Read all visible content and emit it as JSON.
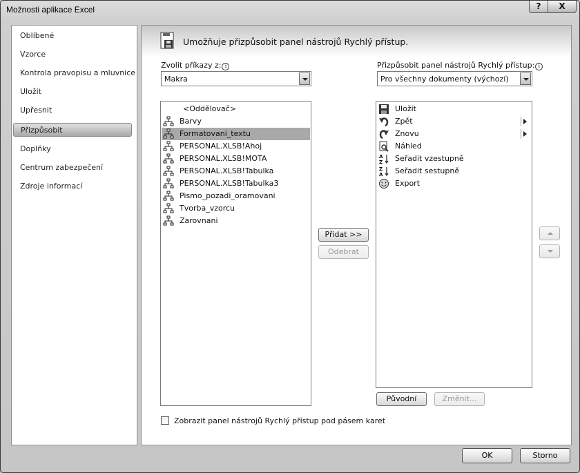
{
  "window": {
    "title": "Možnosti aplikace Excel",
    "help_glyph": "?",
    "close_glyph": "X"
  },
  "sidebar": {
    "items": [
      {
        "label": "Oblíbené",
        "active": false
      },
      {
        "label": "Vzorce",
        "active": false
      },
      {
        "label": "Kontrola pravopisu a mluvnice",
        "active": false
      },
      {
        "label": "Uložit",
        "active": false
      },
      {
        "label": "Upřesnit",
        "active": false
      },
      {
        "label": "Přizpůsobit",
        "active": true
      },
      {
        "label": "Doplňky",
        "active": false
      },
      {
        "label": "Centrum zabezpečení",
        "active": false
      },
      {
        "label": "Zdroje informací",
        "active": false
      }
    ]
  },
  "main": {
    "banner_text": "Umožňuje přizpůsobit panel nástrojů Rychlý přístup.",
    "choose_label": "Zvolit příkazy z:",
    "choose_value": "Makra",
    "customize_label": "Přizpůsobit panel nástrojů Rychlý přístup:",
    "customize_value": "Pro všechny dokumenty (výchozí)",
    "info_glyph": "i",
    "left_list": [
      {
        "label": "<Oddělovač>",
        "icon": "none",
        "selected": false
      },
      {
        "label": "Barvy",
        "icon": "macro-icon",
        "selected": false
      },
      {
        "label": "Formatovani_textu",
        "icon": "macro-icon",
        "selected": true
      },
      {
        "label": "PERSONAL.XLSB!Ahoj",
        "icon": "macro-icon",
        "selected": false
      },
      {
        "label": "PERSONAL.XLSB!MOTA",
        "icon": "macro-icon",
        "selected": false
      },
      {
        "label": "PERSONAL.XLSB!Tabulka",
        "icon": "macro-icon",
        "selected": false
      },
      {
        "label": "PERSONAL.XLSB!Tabulka3",
        "icon": "macro-icon",
        "selected": false
      },
      {
        "label": "Pismo_pozadi_oramovani",
        "icon": "macro-icon",
        "selected": false
      },
      {
        "label": "Tvorba_vzorcu",
        "icon": "macro-icon",
        "selected": false
      },
      {
        "label": "Zarovnani",
        "icon": "macro-icon",
        "selected": false
      }
    ],
    "right_list": [
      {
        "label": "Uložit",
        "icon": "save-icon",
        "submenu": false
      },
      {
        "label": "Zpět",
        "icon": "undo-icon",
        "submenu": true
      },
      {
        "label": "Znovu",
        "icon": "redo-icon",
        "submenu": true
      },
      {
        "label": "Náhled",
        "icon": "print-preview-icon",
        "submenu": false
      },
      {
        "label": "Seřadit vzestupně",
        "icon": "sort-ascending-icon",
        "submenu": false
      },
      {
        "label": "Seřadit sestupně",
        "icon": "sort-descending-icon",
        "submenu": false
      },
      {
        "label": "Export",
        "icon": "smiley-icon",
        "submenu": false
      }
    ],
    "add_button": "Přidat >>",
    "remove_button": "Odebrat",
    "reset_button": "Původní",
    "modify_button": "Změnit...",
    "checkbox_label": "Zobrazit panel nástrojů Rychlý přístup pod pásem karet",
    "checkbox_checked": false
  },
  "footer": {
    "ok": "OK",
    "cancel": "Storno"
  }
}
